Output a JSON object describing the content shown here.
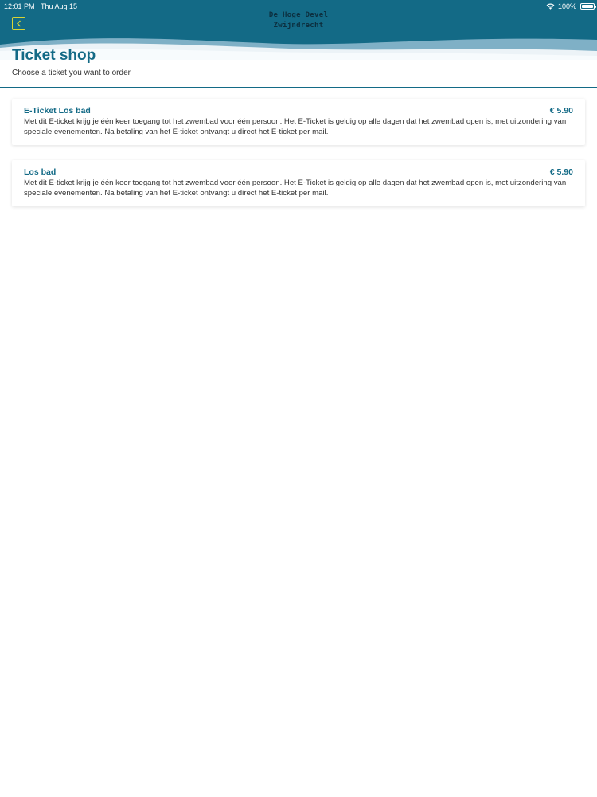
{
  "status_bar": {
    "time": "12:01 PM",
    "date": "Thu Aug 15",
    "battery": "100%",
    "icons": [
      "wifi-icon",
      "battery-icon"
    ]
  },
  "header": {
    "logo_line1": "De Hoge Devel",
    "logo_line2": "Zwijndrecht",
    "back_icon": "chevron-left-icon",
    "colors": {
      "primary": "#136a86",
      "accent": "#d8d435",
      "wave_light": "#7fb0c6"
    }
  },
  "page": {
    "title": "Ticket shop",
    "subtitle": "Choose a ticket you want to order"
  },
  "tickets": [
    {
      "name": "E-Ticket Los bad",
      "price": "€ 5.90",
      "description": "Met dit E-ticket krijg je één keer toegang tot het zwembad voor één persoon. Het E-Ticket is geldig op alle dagen dat het zwembad open is, met uitzondering van speciale evenementen. Na betaling van het E-ticket ontvangt u direct het E-ticket per mail."
    },
    {
      "name": "Los bad",
      "price": "€ 5.90",
      "description": "Met dit E-ticket krijg je één keer toegang tot het zwembad voor één persoon. Het E-Ticket is geldig op alle dagen dat het zwembad open is, met uitzondering van speciale evenementen. Na betaling van het E-ticket ontvangt u direct het E-ticket per mail."
    }
  ]
}
